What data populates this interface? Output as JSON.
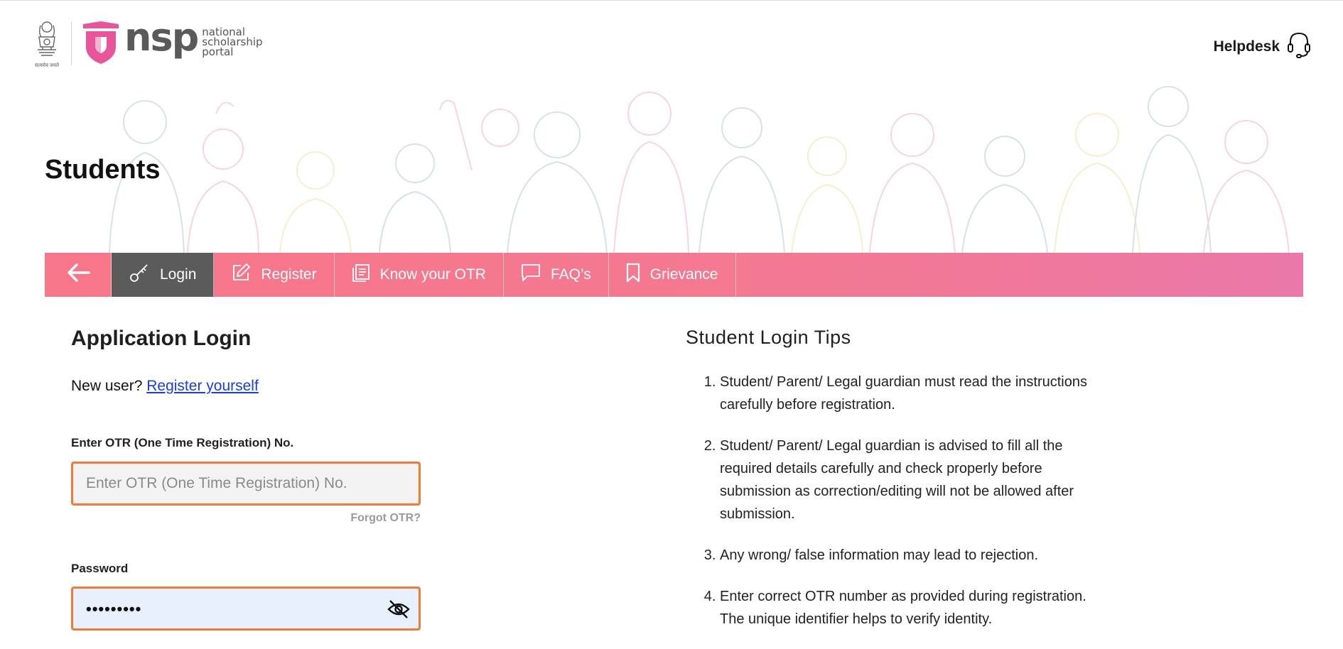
{
  "header": {
    "emblem_caption": "सत्यमेव जयते",
    "logo_wordmark": "nsp",
    "logo_tagline": [
      "national",
      "scholarship",
      "portal"
    ],
    "helpdesk_label": "Helpdesk"
  },
  "hero": {
    "title": "Students"
  },
  "nav": {
    "items": [
      {
        "label": "Login",
        "icon": "key-icon",
        "active": true
      },
      {
        "label": "Register",
        "icon": "edit-icon"
      },
      {
        "label": "Know your OTR",
        "icon": "document-icon"
      },
      {
        "label": "FAQ’s",
        "icon": "chat-icon"
      },
      {
        "label": "Grievance",
        "icon": "bookmark-icon"
      }
    ]
  },
  "login": {
    "title": "Application Login",
    "new_user_text": "New user?",
    "register_link": "Register yourself",
    "otr_label": "Enter OTR (One Time Registration) No.",
    "otr_placeholder": "Enter OTR (One Time Registration) No.",
    "otr_value": "",
    "forgot_otr": "Forgot OTR?",
    "password_label": "Password",
    "password_mask": "•••••••••"
  },
  "tips": {
    "title": "Student Login Tips",
    "items": [
      "Student/ Parent/ Legal guardian must read the instructions carefully before registration.",
      "Student/ Parent/ Legal guardian is advised to fill all the required details carefully and check properly before submission as correction/editing will not be allowed after submission.",
      "Any wrong/ false information may lead to rejection.",
      "Enter correct OTR number as provided during registration. The unique identifier helps to verify identity."
    ]
  },
  "colors": {
    "nav_gradient_start": "#f77689",
    "nav_gradient_end": "#ea78a8",
    "nav_active": "#5b5b5b",
    "input_border": "#f07b37",
    "link": "#1a3ee6",
    "logo_pink": "#e8559b"
  }
}
